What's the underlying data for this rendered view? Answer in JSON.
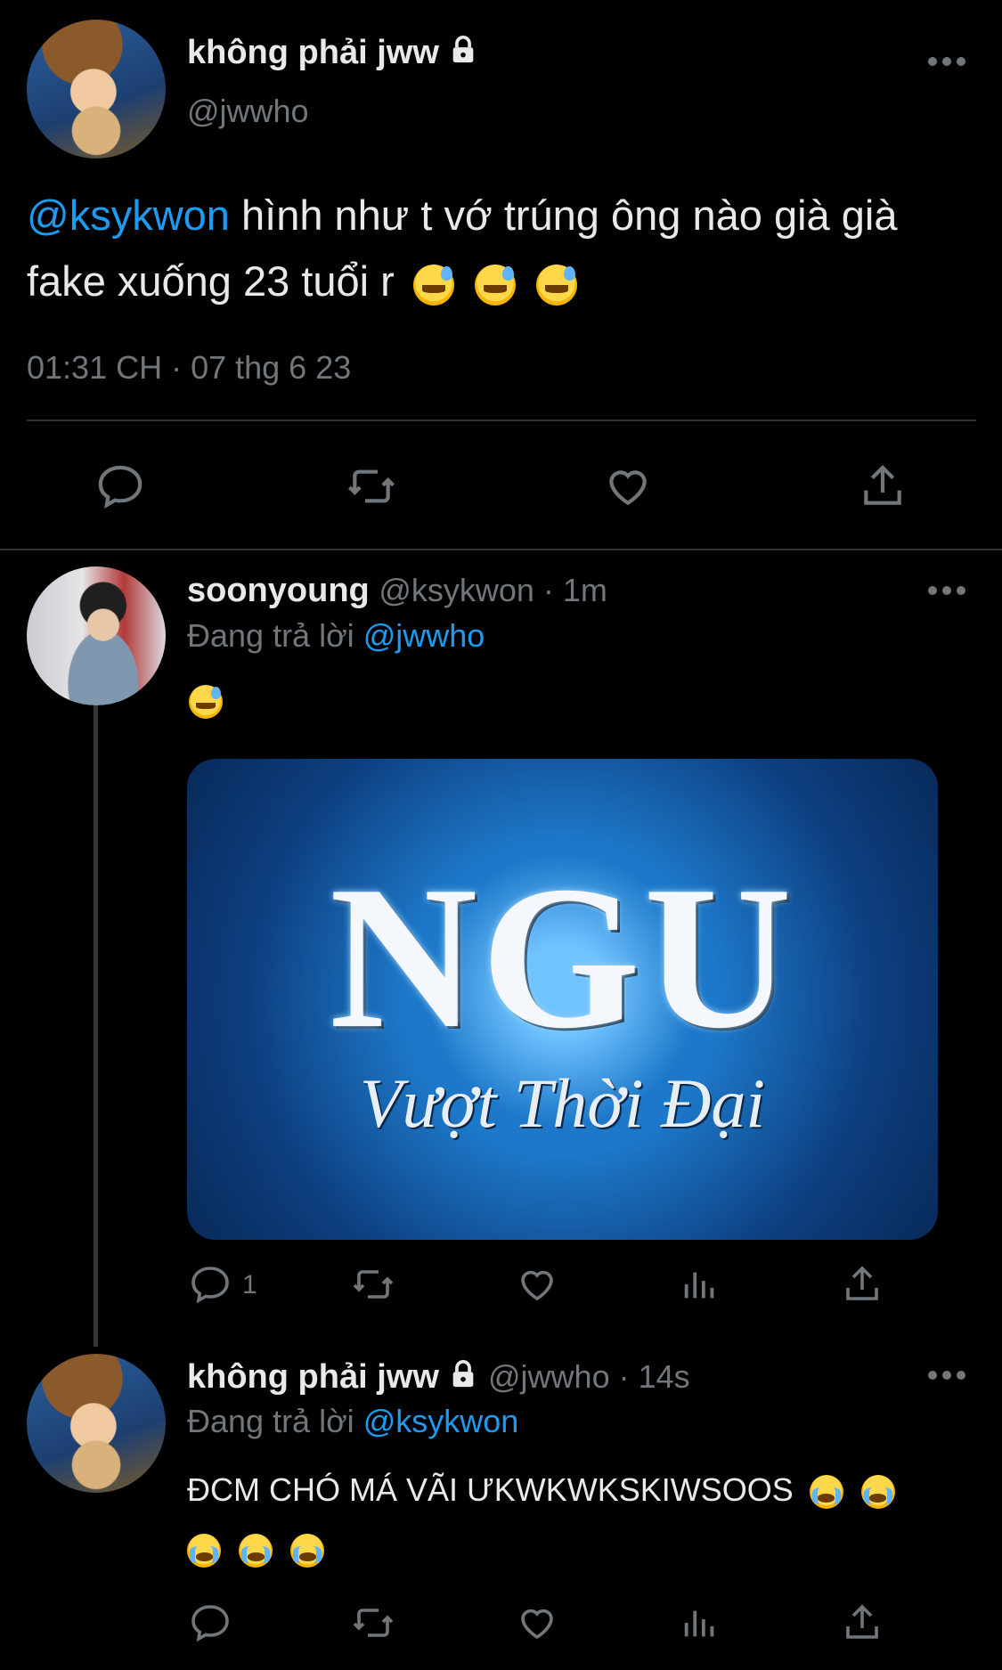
{
  "main_tweet": {
    "display_name": "không phải jww",
    "handle": "@jwwho",
    "mention": "@ksykwon",
    "text_line1": " hình như t vớ trúng ông nào già già",
    "text_line2": "fake xuống 23 tuổi r",
    "emoji": [
      "sweat-smile",
      "sweat-smile",
      "sweat-smile"
    ],
    "timestamp": "01:31 CH · 07 thg 6 23"
  },
  "reply1": {
    "display_name": "soonyoung",
    "handle_time": "@ksykwon · 1m",
    "replying_prefix": "Đang trả lời ",
    "replying_to": "@jwwho",
    "emoji": [
      "sweat-smile"
    ],
    "media_title": "NGU",
    "media_subtitle": "Vượt Thời Đại",
    "reply_count": "1"
  },
  "reply2": {
    "display_name": "không phải jww",
    "handle_time": "@jwwho · 14s",
    "replying_prefix": "Đang trả lời ",
    "replying_to": "@ksykwon",
    "text": "ĐCM CHÓ MÁ VÃI ƯKWKWKSKIWSOOS",
    "emoji": [
      "loudly-crying",
      "loudly-crying",
      "loudly-crying",
      "loudly-crying",
      "loudly-crying"
    ]
  },
  "colors": {
    "background": "#000000",
    "text": "#e7e9ea",
    "muted": "#71767b",
    "link": "#1d9bf0",
    "divider": "#2f3336"
  },
  "icons": [
    "reply-icon",
    "retweet-icon",
    "like-icon",
    "share-icon",
    "analytics-icon",
    "more-icon",
    "lock-icon"
  ]
}
